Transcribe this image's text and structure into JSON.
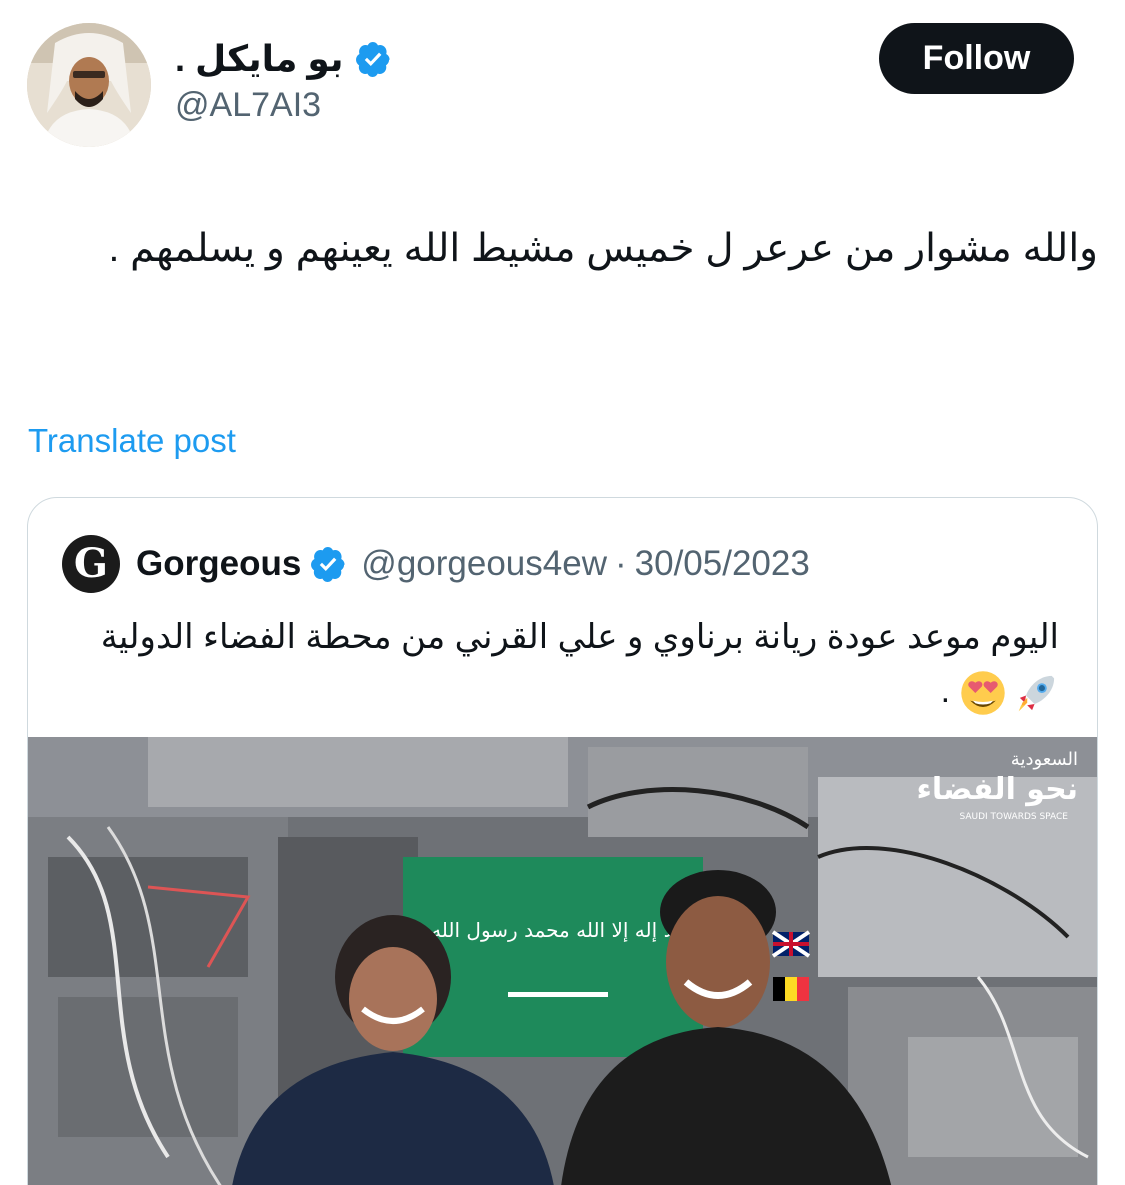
{
  "author": {
    "display_name": "بو مايكل .",
    "handle": "@AL7AI3",
    "verified": true
  },
  "follow_label": "Follow",
  "tweet": {
    "text": "والله مشوار من عرعر ل خميس مشيط الله يعينهم و يسلمهم ."
  },
  "translate_label": "Translate post",
  "quoted": {
    "avatar_letter": "G",
    "name": "Gorgeous",
    "handle": "@gorgeous4ew",
    "separator": "·",
    "date": "30/05/2023",
    "text": "اليوم موعد عودة ريانة برناوي و علي القرني من محطة الفضاء الدولية",
    "text_end": ".",
    "media": {
      "logo_line1": "السعودية",
      "logo_line2": "نحو الفضاء",
      "logo_line3": "SAUDI TOWARDS SPACE",
      "flag_text": "لا إله إلا الله محمد رسول الله"
    }
  },
  "colors": {
    "accent": "#1d9bf0",
    "text_primary": "#0f1419",
    "text_secondary": "#536471",
    "border": "#cfd9de",
    "verified_badge": "#1d9bf0",
    "flag_green": "#1e8a5b"
  },
  "icons": [
    "verified-badge-icon",
    "rocket-emoji",
    "heart-eyes-emoji"
  ]
}
